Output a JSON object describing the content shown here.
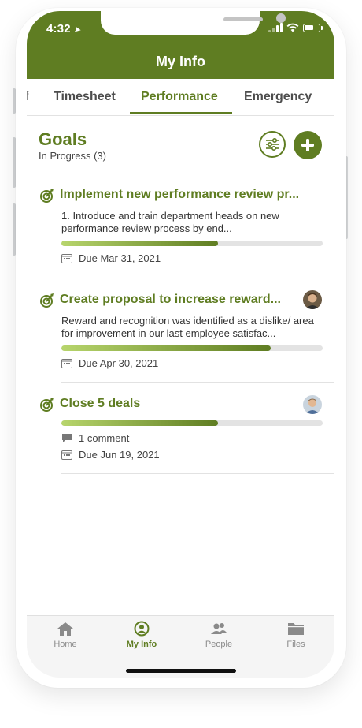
{
  "status": {
    "time": "4:32"
  },
  "header": {
    "title": "My Info"
  },
  "tabs": [
    {
      "label": "Timesheet"
    },
    {
      "label": "Performance",
      "active": true
    },
    {
      "label": "Emergency"
    }
  ],
  "goals": {
    "title": "Goals",
    "subtitle": "In Progress (3)",
    "items": [
      {
        "title": "Implement new performance review pr...",
        "description": "1. Introduce and train department heads on new performance review process by end...",
        "progress": 0.6,
        "due": "Due Mar 31, 2021",
        "has_avatar": false
      },
      {
        "title": "Create proposal to increase reward...",
        "description": "Reward and recognition was identified as a dislike/ area for improvement in our last employee satisfac...",
        "progress": 0.8,
        "due": "Due Apr 30, 2021",
        "has_avatar": true
      },
      {
        "title": "Close 5 deals",
        "progress": 0.6,
        "comments": "1 comment",
        "due": "Due Jun 19, 2021",
        "has_avatar": true
      }
    ]
  },
  "nav": {
    "items": [
      {
        "label": "Home",
        "icon": "home-icon"
      },
      {
        "label": "My Info",
        "icon": "person-circle-icon",
        "active": true
      },
      {
        "label": "People",
        "icon": "people-icon"
      },
      {
        "label": "Files",
        "icon": "folder-icon"
      }
    ]
  },
  "colors": {
    "accent": "#5f7d22",
    "progress_start": "#b7d56c"
  }
}
